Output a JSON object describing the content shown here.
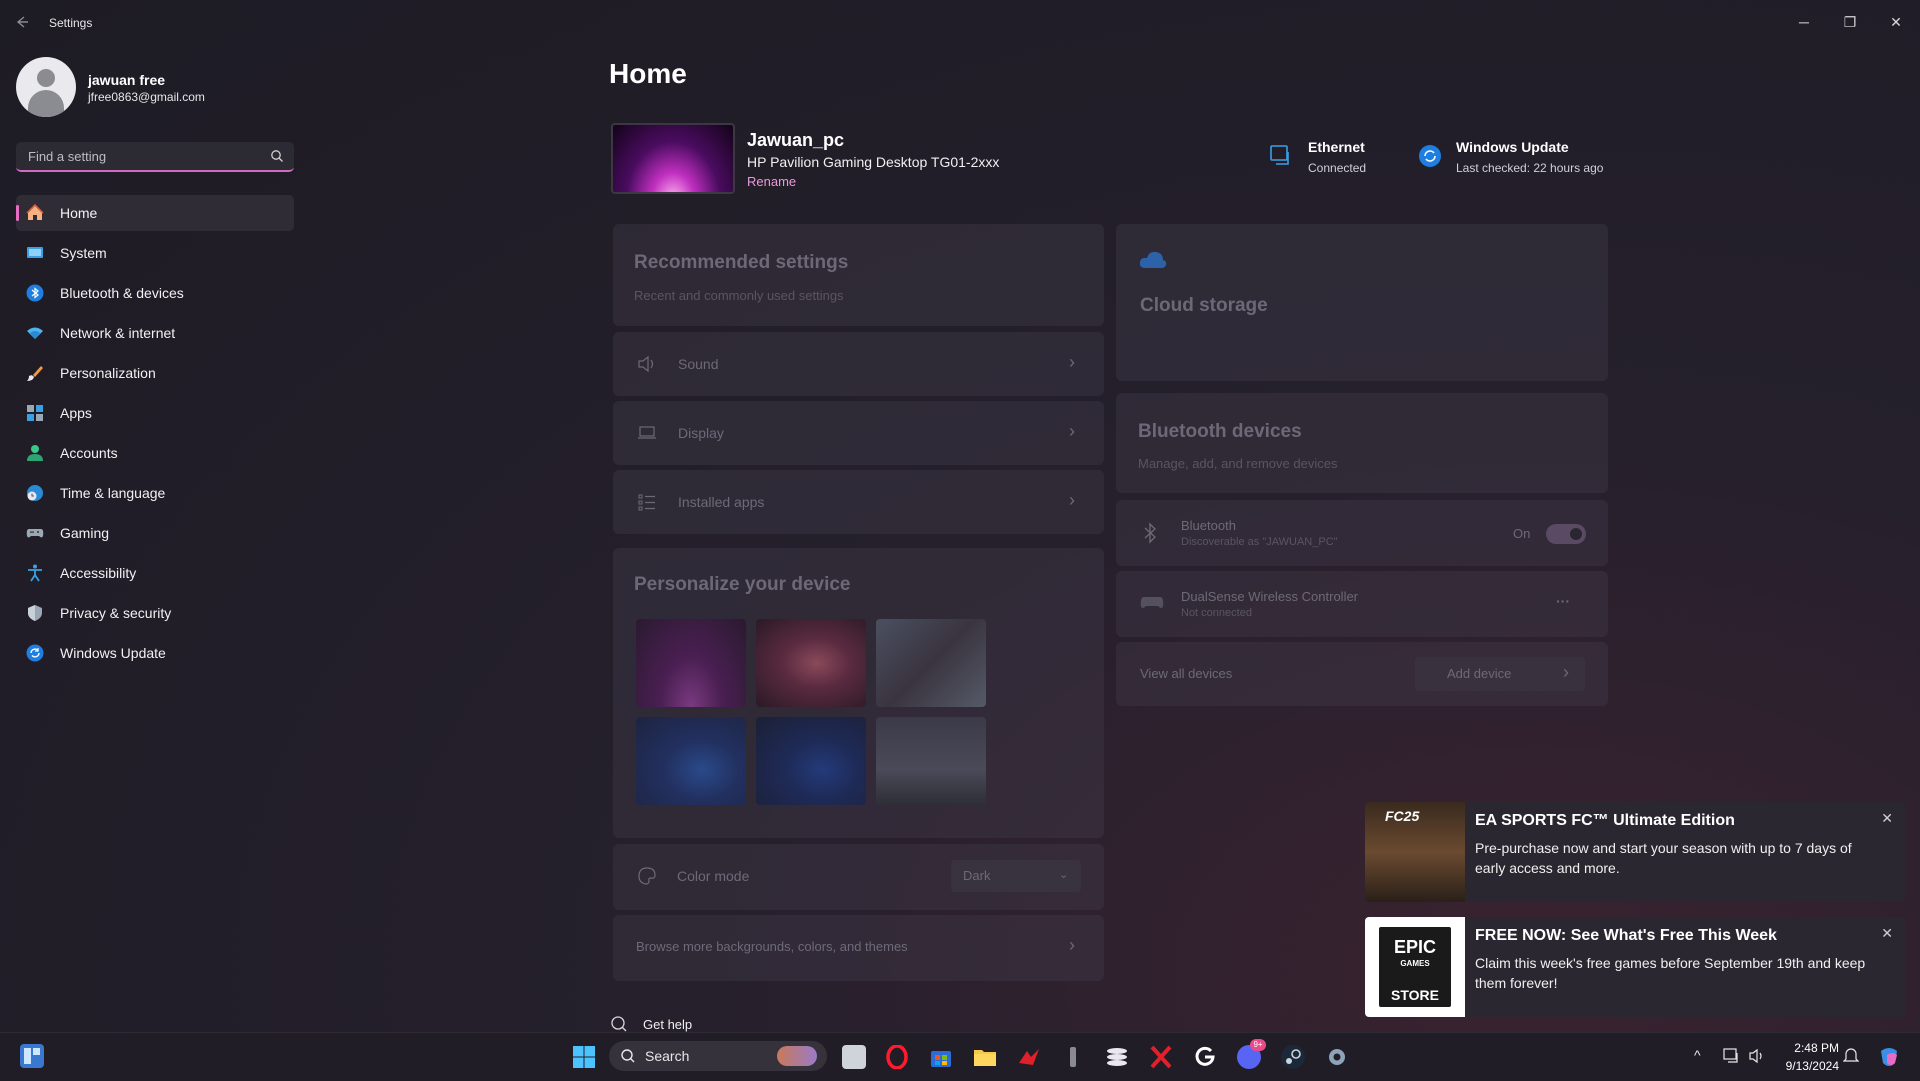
{
  "window": {
    "title": "Settings",
    "controls": {
      "minimize": "─",
      "maximize": "❐",
      "close": "✕"
    }
  },
  "user": {
    "name": "jawuan free",
    "email": "jfree0863@gmail.com"
  },
  "search": {
    "placeholder": "Find a setting"
  },
  "sidebar": {
    "items": [
      {
        "label": "Home",
        "icon": "home-icon",
        "active": true
      },
      {
        "label": "System",
        "icon": "monitor-icon"
      },
      {
        "label": "Bluetooth & devices",
        "icon": "bluetooth-icon"
      },
      {
        "label": "Network & internet",
        "icon": "wifi-icon"
      },
      {
        "label": "Personalization",
        "icon": "brush-icon"
      },
      {
        "label": "Apps",
        "icon": "apps-icon"
      },
      {
        "label": "Accounts",
        "icon": "person-icon"
      },
      {
        "label": "Time & language",
        "icon": "globe-clock-icon"
      },
      {
        "label": "Gaming",
        "icon": "gamepad-icon"
      },
      {
        "label": "Accessibility",
        "icon": "accessibility-icon"
      },
      {
        "label": "Privacy & security",
        "icon": "shield-icon"
      },
      {
        "label": "Windows Update",
        "icon": "sync-icon"
      }
    ]
  },
  "main": {
    "title": "Home",
    "device": {
      "name": "Jawuan_pc",
      "model": "HP Pavilion Gaming Desktop TG01-2xxx",
      "rename": "Rename"
    },
    "status": {
      "ethernet": {
        "title": "Ethernet",
        "sub": "Connected"
      },
      "update": {
        "title": "Windows Update",
        "sub": "Last checked: 22 hours ago"
      }
    },
    "recommended": {
      "title": "Recommended settings",
      "subtitle": "Recent and commonly used settings",
      "rows": [
        "Sound",
        "Display",
        "Installed apps"
      ]
    },
    "cloud": {
      "title": "Cloud storage"
    },
    "bluetooth": {
      "title": "Bluetooth devices",
      "subtitle": "Manage, add, and remove devices",
      "bt_label": "Bluetooth",
      "bt_sub": "Discoverable as \"JAWUAN_PC\"",
      "bt_state": "On",
      "controller_name": "DualSense Wireless Controller",
      "controller_status": "Not connected",
      "more": "···",
      "view_all": "View all devices",
      "add_device": "Add device"
    },
    "personalize": {
      "title": "Personalize your device",
      "color_mode_label": "Color mode",
      "color_mode_value": "Dark",
      "browse": "Browse more backgrounds, colors, and themes"
    },
    "help": "Get help"
  },
  "notifications": [
    {
      "title": "EA SPORTS FC™ Ultimate Edition",
      "body": "Pre-purchase now and start your season with up to 7 days of early access and more.",
      "image_text": "FC25"
    },
    {
      "title": "FREE NOW: See What's Free This Week",
      "body": "Claim this week's free games before September 19th and keep them forever!",
      "image_text_1": "EPIC",
      "image_text_2": "GAMES",
      "image_text_3": "STORE"
    }
  ],
  "taskbar": {
    "search_label": "Search",
    "badge": "9+",
    "time": "2:48 PM",
    "date": "9/13/2024"
  },
  "colors": {
    "accent": "#e86cc6",
    "link": "#e99ad9",
    "background": "#1d1b24"
  }
}
